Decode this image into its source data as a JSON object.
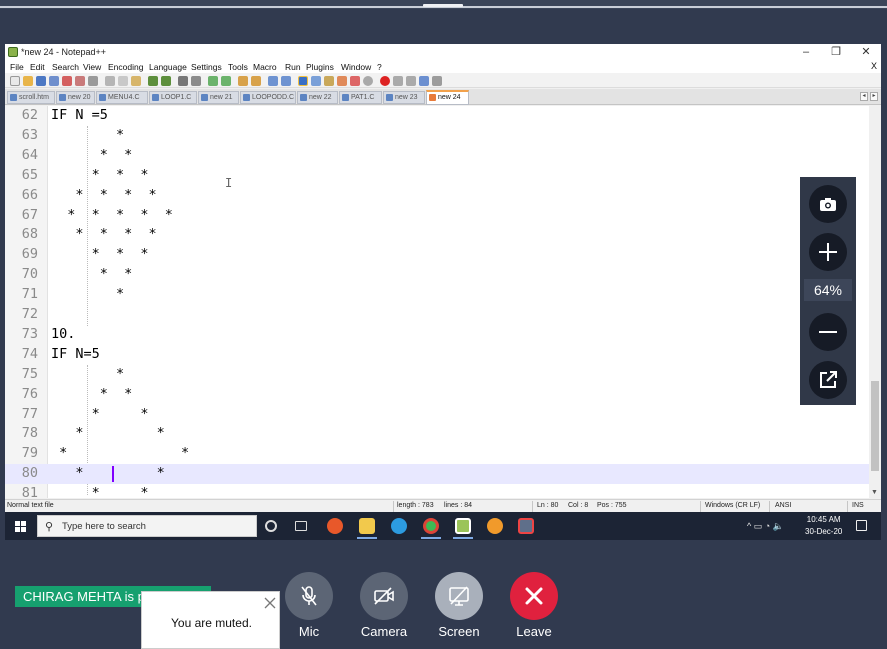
{
  "window": {
    "title": "*new 24 - Notepad++",
    "minimize_glyph": "–",
    "maximize_glyph": "❐",
    "close_glyph": "✕"
  },
  "menu": [
    "File",
    "Edit",
    "Search",
    "View",
    "Encoding",
    "Language",
    "Settings",
    "Tools",
    "Macro",
    "Run",
    "Plugins",
    "Window",
    "?"
  ],
  "menu_close": "X",
  "tabs": [
    {
      "label": "scroll.htm",
      "active": false
    },
    {
      "label": "new 20",
      "active": false
    },
    {
      "label": "MENU4.C",
      "active": false
    },
    {
      "label": "LOOP1.C",
      "active": false
    },
    {
      "label": "new 21",
      "active": false
    },
    {
      "label": "LOOPODD.C",
      "active": false
    },
    {
      "label": "new 22",
      "active": false
    },
    {
      "label": "PAT1.C",
      "active": false
    },
    {
      "label": "new 23",
      "active": false
    },
    {
      "label": "new 24",
      "active": true
    }
  ],
  "tab_scroll": {
    "left": "◂",
    "right": "▸"
  },
  "editor": {
    "lines": [
      {
        "n": "62",
        "text": "IF N =5"
      },
      {
        "n": "63",
        "text": "        *"
      },
      {
        "n": "64",
        "text": "      *  *"
      },
      {
        "n": "65",
        "text": "     *  *  *"
      },
      {
        "n": "66",
        "text": "   *  *  *  *"
      },
      {
        "n": "67",
        "text": "  *  *  *  *  *"
      },
      {
        "n": "68",
        "text": "   *  *  *  *"
      },
      {
        "n": "69",
        "text": "     *  *  *"
      },
      {
        "n": "70",
        "text": "      *  *"
      },
      {
        "n": "71",
        "text": "        *"
      },
      {
        "n": "72",
        "text": ""
      },
      {
        "n": "73",
        "text": "10."
      },
      {
        "n": "74",
        "text": "IF N=5"
      },
      {
        "n": "75",
        "text": "        *"
      },
      {
        "n": "76",
        "text": "      *  *"
      },
      {
        "n": "77",
        "text": "     *     *"
      },
      {
        "n": "78",
        "text": "   *         *"
      },
      {
        "n": "79",
        "text": " *              *"
      },
      {
        "n": "80",
        "text": "   *         *"
      },
      {
        "n": "81",
        "text": "     *     *"
      }
    ],
    "current_line": "80",
    "cursor_glyph": "I"
  },
  "statusbar": {
    "filetype": "Normal text file",
    "length": "length : 783",
    "lines": "lines : 84",
    "ln": "Ln : 80",
    "col": "Col : 8",
    "pos": "Pos : 755",
    "eol": "Windows (CR LF)",
    "encoding": "ANSI",
    "mode": "INS"
  },
  "taskbar": {
    "search_placeholder": "Type here to search",
    "time": "10:45 AM",
    "date": "30-Dec-20",
    "tray_glyphs": "^  ▭  ◔  🔈"
  },
  "zoom": {
    "level": "64%"
  },
  "meeting": {
    "presenter_label": "CHIRAG MEHTA is p",
    "muted_toast": "You are muted.",
    "controls": [
      {
        "label": "Mic"
      },
      {
        "label": "Camera"
      },
      {
        "label": "Screen"
      },
      {
        "label": "Leave"
      }
    ]
  },
  "colors": {
    "background": "#313a4f",
    "presenter_green": "#16a06f",
    "leave_red": "#e0213e",
    "control_gray": "#5c6575",
    "screen_gray": "#a9b0bb",
    "current_line": "#e8e8ff",
    "caret": "#8000ff"
  }
}
